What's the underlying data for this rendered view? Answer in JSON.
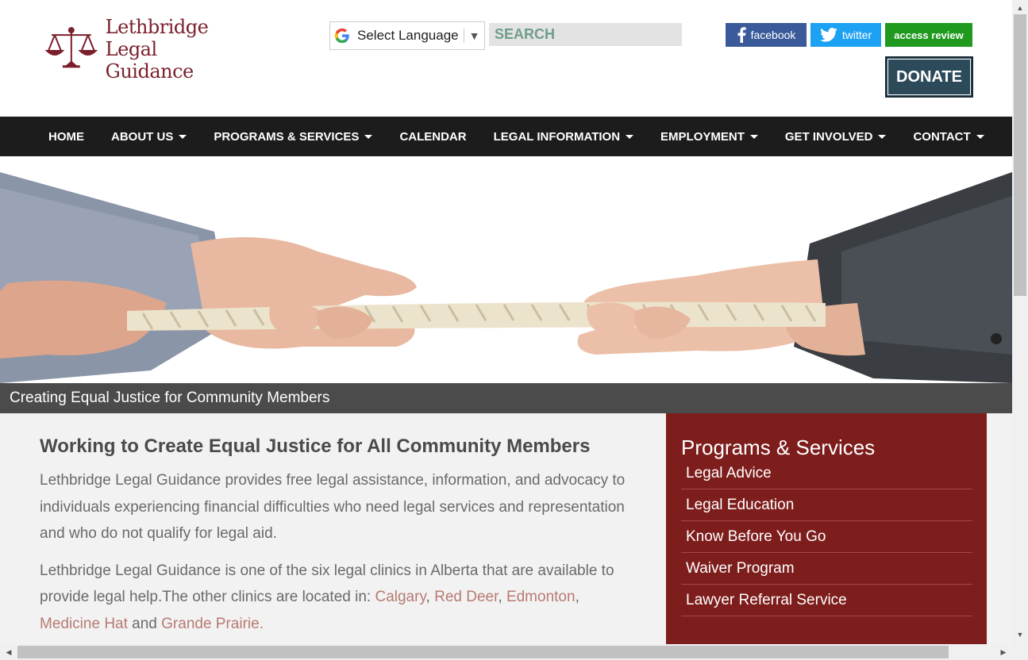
{
  "header": {
    "logo_line1": "Lethbridge",
    "logo_line2": "Legal Guidance",
    "language_select_label": "Select Language",
    "search_placeholder": "SEARCH",
    "social": {
      "facebook": "facebook",
      "twitter": "twitter",
      "access_review": "access review"
    },
    "donate_label": "DONATE"
  },
  "nav": {
    "items": [
      {
        "label": "HOME",
        "has_dropdown": false
      },
      {
        "label": "ABOUT US",
        "has_dropdown": true
      },
      {
        "label": "PROGRAMS & SERVICES",
        "has_dropdown": true
      },
      {
        "label": "CALENDAR",
        "has_dropdown": false
      },
      {
        "label": "LEGAL INFORMATION",
        "has_dropdown": true
      },
      {
        "label": "EMPLOYMENT",
        "has_dropdown": true
      },
      {
        "label": "GET INVOLVED",
        "has_dropdown": true
      },
      {
        "label": "CONTACT",
        "has_dropdown": true
      }
    ]
  },
  "hero": {
    "caption": "Creating Equal Justice for Community Members"
  },
  "article": {
    "heading": "Working to Create Equal Justice for All Community Members",
    "paragraph1": "Lethbridge Legal Guidance provides free legal assistance, information, and advocacy to individuals experiencing financial difficulties who need legal services and representation and who do not qualify for legal aid.",
    "paragraph2_intro": "Lethbridge Legal Guidance is one of the six legal clinics in Alberta that are available to provide legal help.The other clinics are located in: ",
    "clinic_links": [
      "Calgary",
      "Red Deer",
      "Edmonton",
      "Medicine Hat"
    ],
    "separator": ", ",
    "and_text": " and ",
    "last_link": "Grande Prairie."
  },
  "sidebar": {
    "title": "Programs & Services",
    "items": [
      "Legal Advice",
      "Legal Education",
      "Know Before You Go",
      "Waiver Program",
      "Lawyer Referral Service"
    ]
  },
  "colors": {
    "brand": "#7a1f2b",
    "nav_bg": "#1c1c1c",
    "sidebar_bg": "#7d1d1c",
    "donate_bg": "#2d4a5a",
    "link": "#b87a72"
  }
}
